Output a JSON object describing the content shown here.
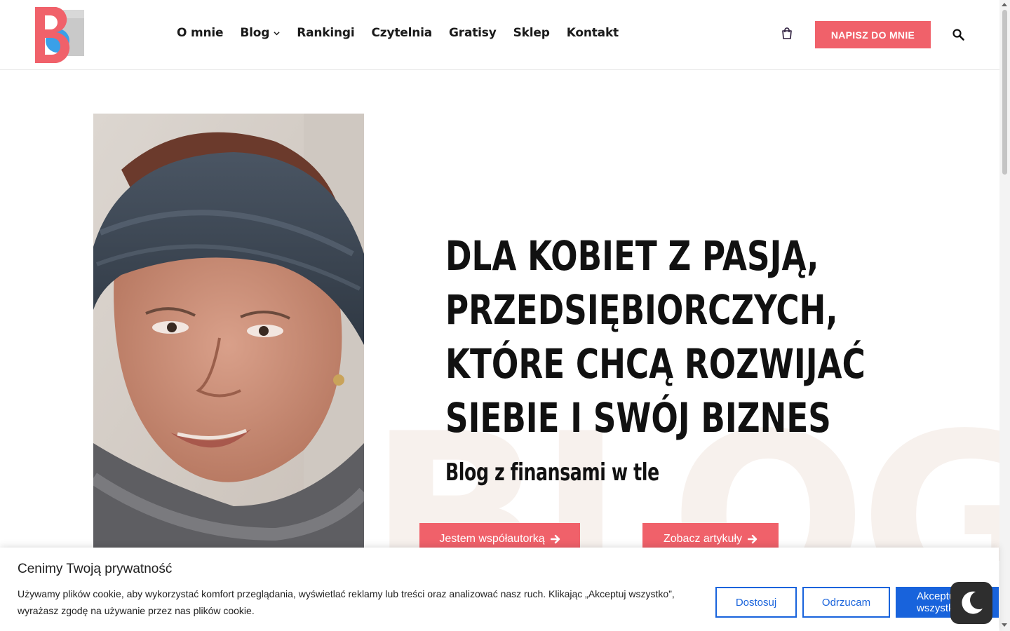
{
  "header": {
    "logo_alt": "BF",
    "nav": [
      {
        "label": "O mnie"
      },
      {
        "label": "Blog",
        "has_dropdown": true
      },
      {
        "label": "Rankingi"
      },
      {
        "label": "Czytelnia"
      },
      {
        "label": "Gratisy"
      },
      {
        "label": "Sklep"
      },
      {
        "label": "Kontakt"
      }
    ],
    "cta_label": "NAPISZ DO MNIE",
    "icons": [
      "cart-icon",
      "search-icon"
    ]
  },
  "hero": {
    "headline_lines": [
      "DLA KOBIET Z PASJĄ,",
      "PRZEDSIĘBIORCZYCH,",
      "KTÓRE CHCĄ ROZWIJAĆ",
      "SIEBIE I SWÓJ BIZNES"
    ],
    "subtitle": "Blog z finansami w tle",
    "background_word": "BLOG",
    "buttons": [
      {
        "label": "Jestem współautorką"
      },
      {
        "label": "Zobacz artykuły"
      }
    ]
  },
  "cookie_banner": {
    "title": "Cenimy Twoją prywatność",
    "text": "Używamy plików cookie, aby wykorzystać komfort przeglądania, wyświetlać reklamy lub treści oraz analizować nasz ruch. Klikając „Akceptuj wszystko”, wyrażasz zgodę na używanie przez nas plików cookie.",
    "customize_label": "Dostosuj",
    "reject_label": "Odrzucam",
    "accept_label": "Akceptuj wszystko"
  },
  "colors": {
    "accent": "#f0616a",
    "cookie_blue": "#1863dc",
    "bg_word": "#f7f1ed",
    "logo_red": "#f0616a",
    "logo_blue": "#3aa0e8",
    "logo_grey": "#bdbdbd"
  }
}
